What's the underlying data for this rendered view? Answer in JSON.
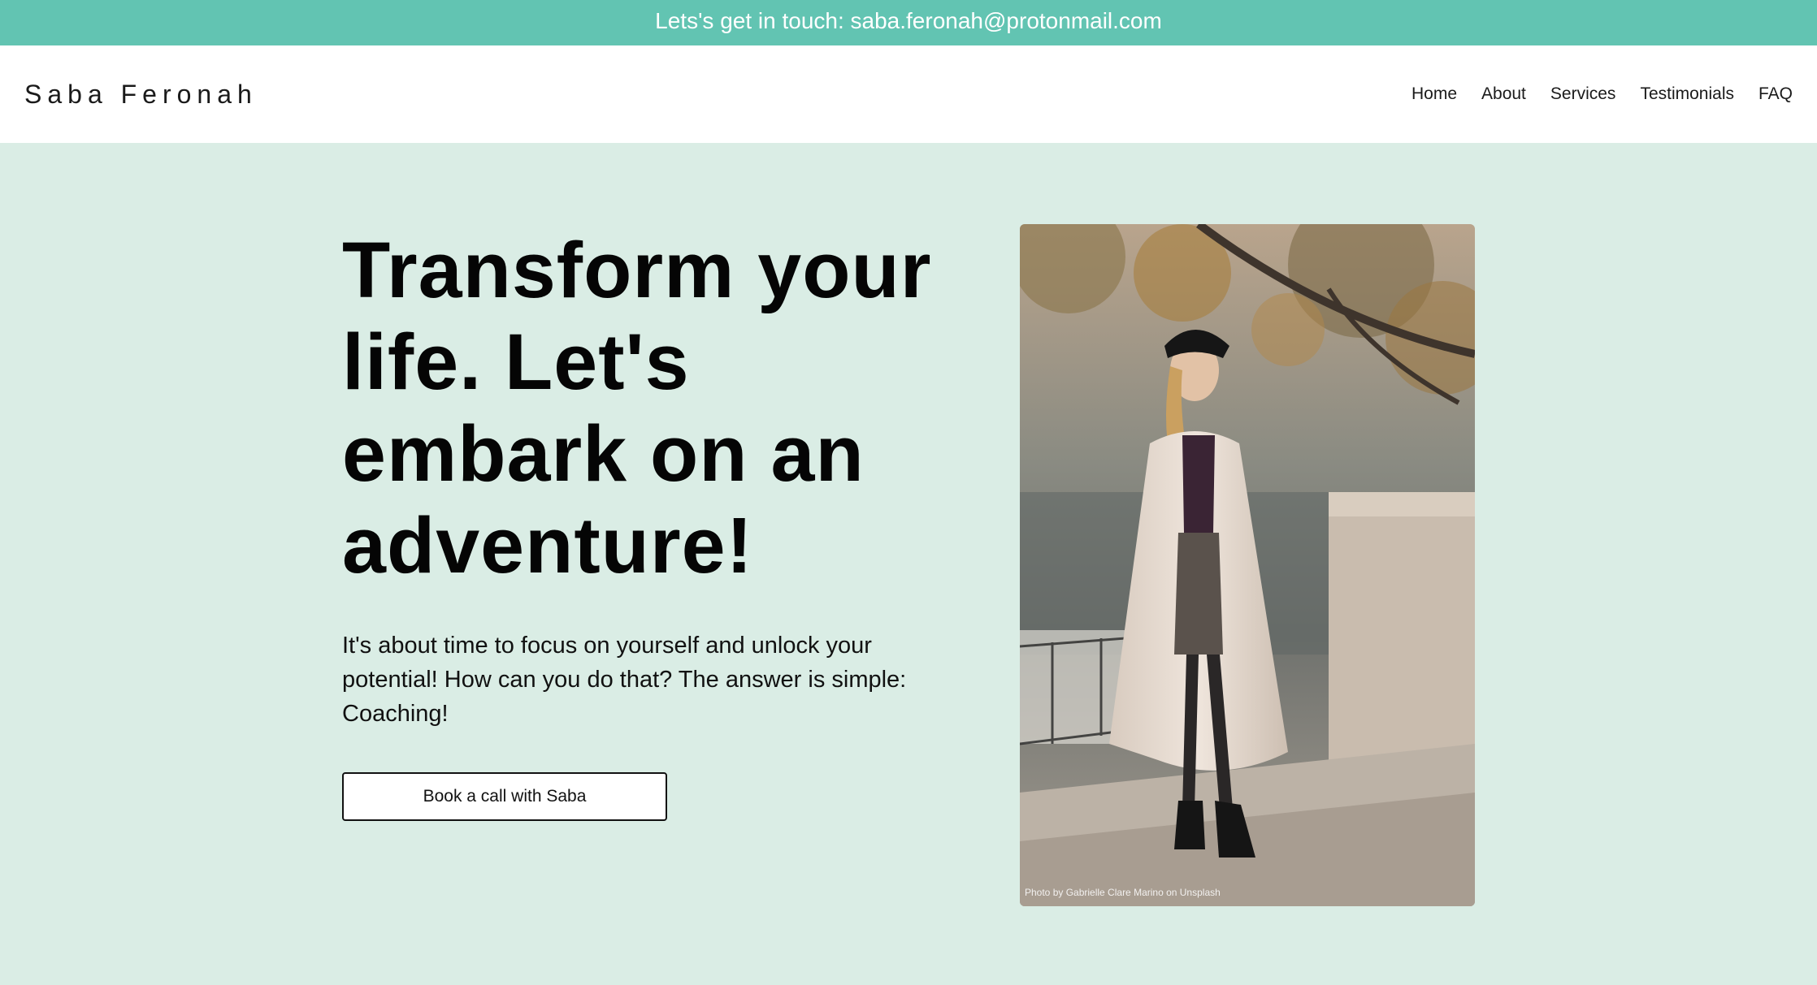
{
  "topbar": {
    "text": "Lets's get in touch: saba.feronah@protonmail.com"
  },
  "header": {
    "brand": "Saba Feronah",
    "nav": [
      "Home",
      "About",
      "Services",
      "Testimonials",
      "FAQ"
    ]
  },
  "hero": {
    "headline": "Transform your life. Let's embark on an adventure!",
    "lede": "It's about time to focus on yourself and unlock your potential! How can you do that? The answer is simple: Coaching!",
    "cta_label": "Book a call with Saba",
    "photo_credit": "Photo by Gabrielle Clare Marino on Unsplash"
  },
  "colors": {
    "topbar": "#62c4b2",
    "hero_background": "#daede5",
    "text": "#0a0a0a"
  }
}
